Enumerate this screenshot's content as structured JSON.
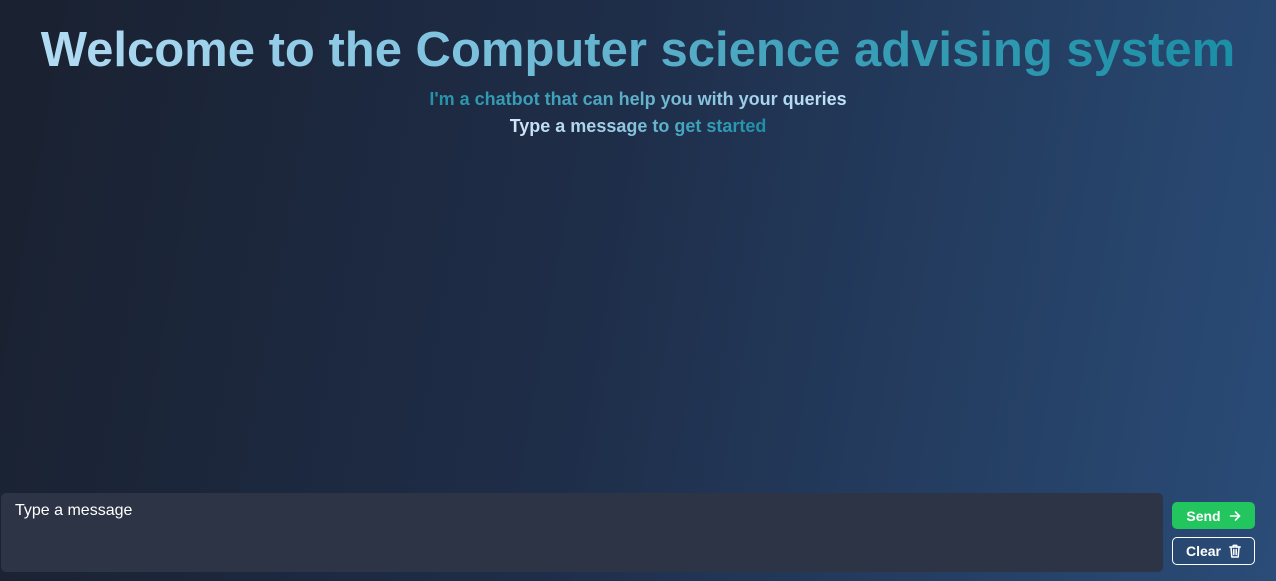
{
  "hero": {
    "title": "Welcome to the Computer science advising system",
    "subtitle_line1": "I'm a chatbot that can help you with your queries",
    "subtitle_line2": "Type a message to get started"
  },
  "composer": {
    "placeholder": "Type a message"
  },
  "actions": {
    "send_label": "Send",
    "send_icon": "arrow-right-icon",
    "clear_label": "Clear",
    "clear_icon": "trash-icon"
  },
  "colors": {
    "send_button": "#22c55e",
    "composer_bg": "#2c3446"
  }
}
